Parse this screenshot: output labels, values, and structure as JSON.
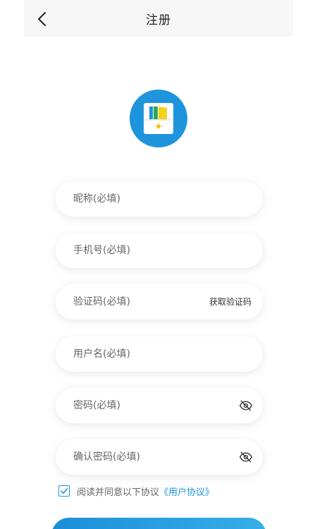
{
  "header": {
    "title": "注册"
  },
  "form": {
    "nickname_placeholder": "昵称(必填)",
    "phone_placeholder": "手机号(必填)",
    "code_placeholder": "验证码(必填)",
    "get_code_label": "获取验证码",
    "username_placeholder": "用户名(必填)",
    "password_placeholder": "密码(必填)",
    "confirm_placeholder": "确认密码(必填)"
  },
  "agreement": {
    "checked": true,
    "text": "阅读并同意以下协议",
    "link": "《用户协议》"
  },
  "icons": {
    "back": "chevron-left-icon",
    "logo": "app-logo-icon",
    "password_toggle": "eye-off-icon",
    "check": "check-icon"
  },
  "colors": {
    "accent": "#1e94dc",
    "header_bg": "#f7f7f7",
    "placeholder": "#666666"
  }
}
